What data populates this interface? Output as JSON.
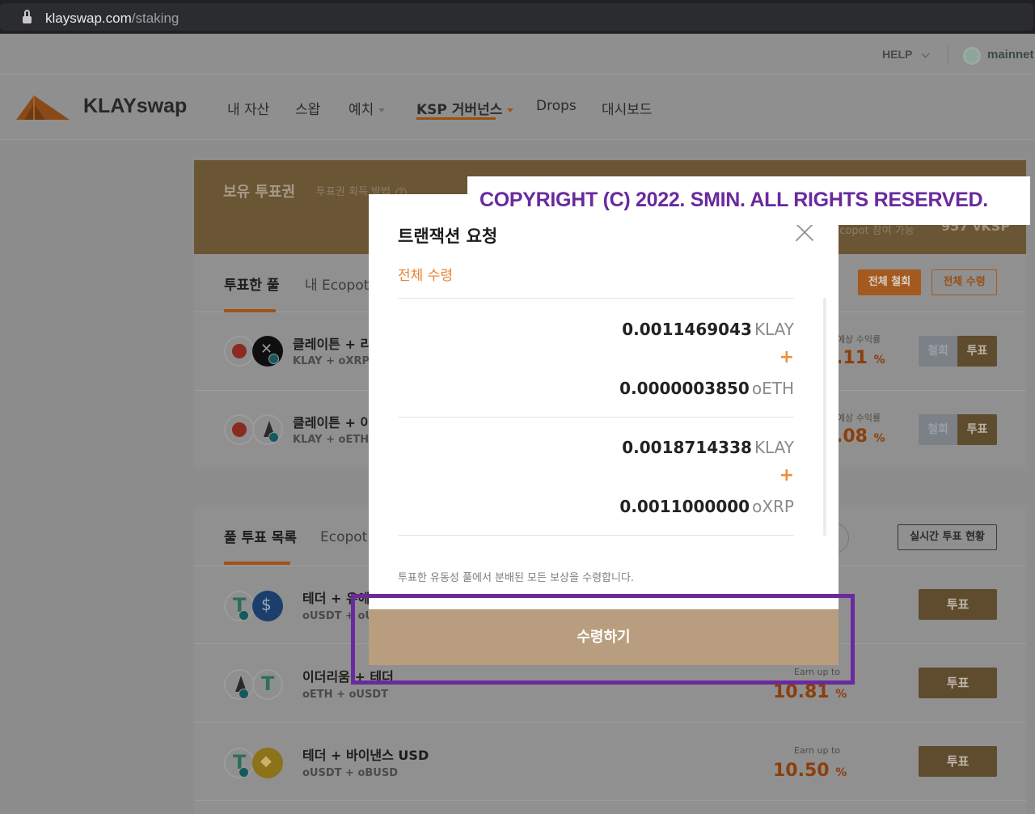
{
  "browser": {
    "domain": "klayswap.com",
    "path": "/staking"
  },
  "topbar": {
    "help": "HELP",
    "network": "mainnet"
  },
  "nav": {
    "logo": "KLAYswap",
    "items": [
      "내 자산",
      "스왑",
      "예치",
      "KSP 거버넌스",
      "Drops",
      "대시보드"
    ],
    "active": "KSP 거버넌스"
  },
  "vote_card": {
    "title": "보유 투표권",
    "how_to": "투표권 획득 방법",
    "ecopot_label": "Ecopot 참여 가능",
    "ecopot_value": "957 vKSP",
    "tabs": [
      "투표한 풀",
      "내 Ecopot"
    ],
    "btn_withdraw_all": "전체 철회",
    "btn_claim_all": "전체 수령",
    "rows": [
      {
        "name": "클레이튼 + 리",
        "pair": "KLAY + oXRP",
        "earn_label": "예상 수익률",
        "earn": ".11",
        "pct": "%",
        "btn_withdraw": "철회",
        "btn_vote": "투표"
      },
      {
        "name": "클레이튼 + 이",
        "pair": "KLAY + oETH",
        "earn_label": "예상 수익률",
        "earn": ".08",
        "pct": "%",
        "btn_withdraw": "철회",
        "btn_vote": "투표"
      }
    ]
  },
  "list_card": {
    "tabs": [
      "풀 투표 목록",
      "Ecopot"
    ],
    "btn_realtime": "실시간 투표 현황",
    "rows": [
      {
        "name": "테더 + 유에",
        "pair": "oUSDT + oUS",
        "earn_label": "",
        "earn": "",
        "pct": "",
        "btn_vote": "투표"
      },
      {
        "name": "이더리움 + 테더",
        "pair": "oETH + oUSDT",
        "earn_label": "Earn up to",
        "earn": "10.81",
        "pct": "%",
        "btn_vote": "투표"
      },
      {
        "name": "테더 + 바이낸스 USD",
        "pair": "oUSDT + oBUSD",
        "earn_label": "Earn up to",
        "earn": "10.50",
        "pct": "%",
        "btn_vote": "투표"
      }
    ]
  },
  "modal": {
    "title": "트랜잭션 요청",
    "subtitle": "전체 수령",
    "groups": [
      {
        "a_amount": "0.0011469043",
        "a_unit": "KLAY",
        "plus": "+",
        "b_amount": "0.0000003850",
        "b_unit": "oETH"
      },
      {
        "a_amount": "0.0018714338",
        "a_unit": "KLAY",
        "plus": "+",
        "b_amount": "0.0011000000",
        "b_unit": "oXRP"
      }
    ],
    "note": "투표한 유동성 풀에서 분배된 모든 보상을 수령합니다.",
    "button": "수령하기"
  },
  "watermark": "COPYRIGHT (C) 2022. SMIN. ALL RIGHTS RESERVED.",
  "colors": {
    "accent": "#e8822f",
    "claim_button": "#b89e7e",
    "highlight": "#6a2a9e"
  }
}
